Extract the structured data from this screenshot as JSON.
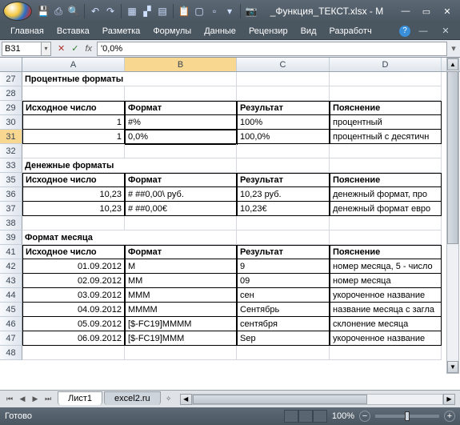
{
  "title": "_Функция_ТЕКСТ.xlsx - M",
  "ribbon": [
    "Главная",
    "Вставка",
    "Разметка",
    "Формулы",
    "Данные",
    "Рецензир",
    "Вид",
    "Разработч"
  ],
  "name_box": "B31",
  "formula": "'0,0%",
  "columns": [
    "A",
    "B",
    "C",
    "D"
  ],
  "rows": [
    {
      "n": 27,
      "cells": [
        {
          "t": "Процентные форматы",
          "bold": true,
          "span": 2
        },
        {
          "t": ""
        },
        {
          "t": ""
        }
      ]
    },
    {
      "n": 28,
      "cells": [
        {
          "t": ""
        },
        {
          "t": ""
        },
        {
          "t": ""
        },
        {
          "t": ""
        }
      ]
    },
    {
      "n": 29,
      "hdr": true,
      "cells": [
        {
          "t": "Исходное число",
          "bold": true
        },
        {
          "t": "Формат",
          "bold": true
        },
        {
          "t": "Результат",
          "bold": true
        },
        {
          "t": "Пояснение",
          "bold": true
        }
      ]
    },
    {
      "n": 30,
      "br": true,
      "cells": [
        {
          "t": "1",
          "r": true
        },
        {
          "t": "#%"
        },
        {
          "t": "100%"
        },
        {
          "t": "процентный"
        }
      ]
    },
    {
      "n": 31,
      "br": true,
      "sel": true,
      "cells": [
        {
          "t": "1",
          "r": true
        },
        {
          "t": "0,0%",
          "active": true
        },
        {
          "t": "100,0%"
        },
        {
          "t": "процентный с десятичн"
        }
      ]
    },
    {
      "n": 32,
      "cells": [
        {
          "t": ""
        },
        {
          "t": ""
        },
        {
          "t": ""
        },
        {
          "t": ""
        }
      ]
    },
    {
      "n": 33,
      "cells": [
        {
          "t": "Денежные форматы",
          "bold": true,
          "span": 2
        },
        {
          "t": ""
        },
        {
          "t": ""
        }
      ]
    },
    {
      "n": 35,
      "hdr": true,
      "cells": [
        {
          "t": "Исходное число",
          "bold": true
        },
        {
          "t": "Формат",
          "bold": true
        },
        {
          "t": "Результат",
          "bold": true
        },
        {
          "t": "Пояснение",
          "bold": true
        }
      ]
    },
    {
      "n": 36,
      "br": true,
      "cells": [
        {
          "t": "10,23",
          "r": true
        },
        {
          "t": "# ##0,00\\ руб."
        },
        {
          "t": "10,23 руб."
        },
        {
          "t": "денежный формат, про"
        }
      ]
    },
    {
      "n": 37,
      "br": true,
      "cells": [
        {
          "t": "10,23",
          "r": true
        },
        {
          "t": "# ##0,00€"
        },
        {
          "t": "10,23€"
        },
        {
          "t": "денежный формат евро"
        }
      ]
    },
    {
      "n": 38,
      "cells": [
        {
          "t": ""
        },
        {
          "t": ""
        },
        {
          "t": ""
        },
        {
          "t": ""
        }
      ]
    },
    {
      "n": 39,
      "cells": [
        {
          "t": "Формат месяца",
          "bold": true,
          "span": 2
        },
        {
          "t": ""
        },
        {
          "t": ""
        }
      ]
    },
    {
      "n": 41,
      "hdr": true,
      "cells": [
        {
          "t": "Исходное число",
          "bold": true
        },
        {
          "t": "Формат",
          "bold": true
        },
        {
          "t": "Результат",
          "bold": true
        },
        {
          "t": "Пояснение",
          "bold": true
        }
      ]
    },
    {
      "n": 42,
      "br": true,
      "cells": [
        {
          "t": "01.09.2012",
          "r": true
        },
        {
          "t": "М"
        },
        {
          "t": "9"
        },
        {
          "t": "номер месяца, 5 - число"
        }
      ]
    },
    {
      "n": 43,
      "br": true,
      "cells": [
        {
          "t": "02.09.2012",
          "r": true
        },
        {
          "t": "ММ"
        },
        {
          "t": "09"
        },
        {
          "t": "номер месяца"
        }
      ]
    },
    {
      "n": 44,
      "br": true,
      "cells": [
        {
          "t": "03.09.2012",
          "r": true
        },
        {
          "t": "МММ"
        },
        {
          "t": "сен"
        },
        {
          "t": "укороченное название"
        }
      ]
    },
    {
      "n": 45,
      "br": true,
      "cells": [
        {
          "t": "04.09.2012",
          "r": true
        },
        {
          "t": "ММММ"
        },
        {
          "t": "Сентябрь"
        },
        {
          "t": "название месяца с загла"
        }
      ]
    },
    {
      "n": 46,
      "br": true,
      "cells": [
        {
          "t": "05.09.2012",
          "r": true
        },
        {
          "t": "[$-FC19]ММММ"
        },
        {
          "t": "сентября"
        },
        {
          "t": "склонение месяца"
        }
      ]
    },
    {
      "n": 47,
      "br": true,
      "cells": [
        {
          "t": "06.09.2012",
          "r": true
        },
        {
          "t": "[$-FC19]МММ"
        },
        {
          "t": "Sep"
        },
        {
          "t": "укороченное название"
        }
      ]
    },
    {
      "n": 48,
      "cells": [
        {
          "t": ""
        },
        {
          "t": ""
        },
        {
          "t": ""
        },
        {
          "t": ""
        }
      ]
    }
  ],
  "sheet_tabs": [
    "Лист1",
    "excel2.ru"
  ],
  "status": "Готово",
  "zoom": "100%"
}
